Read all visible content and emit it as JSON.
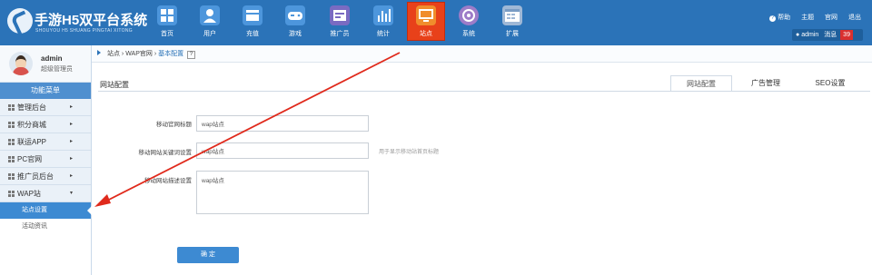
{
  "brand": {
    "title": "手游H5双平台系统",
    "subtitle": "SHOUYOU H5 SHUANG PINGTAI XITONG"
  },
  "nav": [
    {
      "label": "首页",
      "icon": "home-icon",
      "color": "#4d96dc"
    },
    {
      "label": "用户",
      "icon": "user-icon",
      "color": "#4d96dc"
    },
    {
      "label": "充值",
      "icon": "recharge-icon",
      "color": "#4d96dc"
    },
    {
      "label": "游戏",
      "icon": "gamepad-icon",
      "color": "#4d96dc"
    },
    {
      "label": "推广员",
      "icon": "promoter-icon",
      "color": "#7a6bc2"
    },
    {
      "label": "统计",
      "icon": "chart-icon",
      "color": "#4d96dc"
    },
    {
      "label": "站点",
      "icon": "site-icon",
      "color": "#f08d2c"
    },
    {
      "label": "系统",
      "icon": "system-icon",
      "color": "#9d7cc8"
    },
    {
      "label": "扩展",
      "icon": "extension-icon",
      "color": "#9fb8d6"
    }
  ],
  "top_links": {
    "help": "帮助",
    "theme": "主题",
    "website": "官网",
    "logout": "退出"
  },
  "user": {
    "name": "admin",
    "message_label": "消息",
    "message_count": "39"
  },
  "profile": {
    "name": "admin",
    "role": "超级管理员"
  },
  "sidebar": {
    "title": "功能菜单",
    "items": [
      {
        "label": "管理后台",
        "arrow": "▸"
      },
      {
        "label": "积分商城",
        "arrow": "▸"
      },
      {
        "label": "联运APP",
        "arrow": "▸"
      },
      {
        "label": "PC官网",
        "arrow": "▸"
      },
      {
        "label": "推广员后台",
        "arrow": "▸"
      },
      {
        "label": "WAP站",
        "arrow": "▾"
      }
    ],
    "sub_items": [
      "站点设置",
      "活动资讯"
    ]
  },
  "breadcrumb": {
    "root": "站点",
    "sep1": "›",
    "mid": "WAP官网",
    "sep2": "›",
    "current": "基本配置",
    "help": "?"
  },
  "page": {
    "title": "网站配置",
    "tabs": [
      "网站配置",
      "广告管理",
      "SEO设置"
    ]
  },
  "form": {
    "fields": [
      {
        "label": "移动官网标题",
        "value": "wap站点"
      },
      {
        "label": "移动网站关键词设置",
        "value": "wap站点"
      },
      {
        "label": "移动网站描述设置",
        "value": "wap站点"
      }
    ],
    "hint": "用于显示移动站首页标题",
    "submit_label": "确 定"
  },
  "annotation": {
    "color": "#e02a1c"
  }
}
